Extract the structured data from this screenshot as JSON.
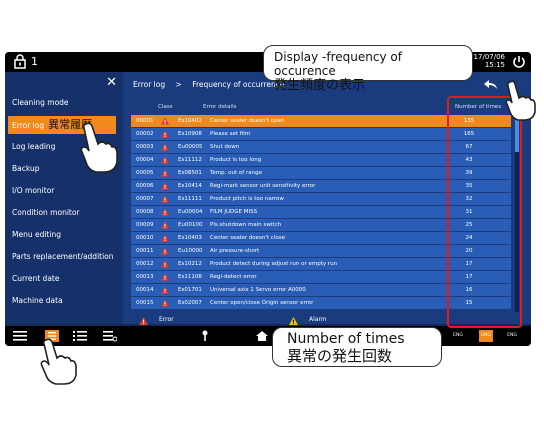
{
  "topbar": {
    "unit_number": "1",
    "date": "17/07/06",
    "time": "15:15"
  },
  "sidebar": {
    "items": [
      {
        "label": "Cleaning mode"
      },
      {
        "label": "Error log",
        "jp": "異常履歴"
      },
      {
        "label": "Log leading"
      },
      {
        "label": "Backup"
      },
      {
        "label": "I/O monitor"
      },
      {
        "label": "Condition monitor"
      },
      {
        "label": "Menu editing"
      },
      {
        "label": "Parts replacement/addition"
      },
      {
        "label": "Current date"
      },
      {
        "label": "Machine data"
      }
    ]
  },
  "breadcrumb": {
    "root": "Error log",
    "sep": ">",
    "current": "Frequency of occurrence"
  },
  "table": {
    "headers": {
      "class": "Class",
      "details": "Error details",
      "count": "Number of times"
    },
    "rows": [
      {
        "no": "00001",
        "code": "Es10402",
        "details": "Center sealer doesn't open",
        "count": "135"
      },
      {
        "no": "00002",
        "code": "Es10908",
        "details": "Please set film",
        "count": "165"
      },
      {
        "no": "00003",
        "code": "Eu00005",
        "details": "Shut down",
        "count": "67"
      },
      {
        "no": "00004",
        "code": "Es11112",
        "details": "Product is too long",
        "count": "43"
      },
      {
        "no": "00005",
        "code": "Es08501",
        "details": "Temp. out of range",
        "count": "39"
      },
      {
        "no": "00006",
        "code": "Es10414",
        "details": "Regi-mark sensor unit sensitivity error",
        "count": "35"
      },
      {
        "no": "00007",
        "code": "Es11111",
        "details": "Product pitch is too narrow",
        "count": "32"
      },
      {
        "no": "00008",
        "code": "Eu00004",
        "details": "FILM JUDGE MISS",
        "count": "31"
      },
      {
        "no": "00009",
        "code": "Eu00100",
        "details": "Pls.shutdown main switch",
        "count": "25"
      },
      {
        "no": "00010",
        "code": "Es10403",
        "details": "Center sealer doesn't close",
        "count": "24"
      },
      {
        "no": "00011",
        "code": "Eu10000",
        "details": "Air pressure-short",
        "count": "20"
      },
      {
        "no": "00012",
        "code": "Es10212",
        "details": "Product detect during adjust run or empty run",
        "count": "17"
      },
      {
        "no": "00013",
        "code": "Es11108",
        "details": "Regi-detect error",
        "count": "17"
      },
      {
        "no": "00014",
        "code": "Es01701",
        "details": "Universal axis 1 Servo error A0000",
        "count": "16"
      },
      {
        "no": "00015",
        "code": "Es02007",
        "details": "Center open/close Origin sensor error",
        "count": "15"
      }
    ]
  },
  "legend": {
    "error": "Error",
    "alarm": "Alarm"
  },
  "bottombar": {
    "lang1": "ENG",
    "lang2": "ENG"
  },
  "callouts": {
    "top_en": "Display -frequency of occurence",
    "top_jp": "発生頻度の表示",
    "bottom_en": "Number of times",
    "bottom_jp": "異常の発生回数"
  },
  "colors": {
    "accent": "#f08a1c",
    "screen_bg": "#14285a",
    "row_bg": "#2a5db5",
    "highlight_box": "#e61919"
  }
}
